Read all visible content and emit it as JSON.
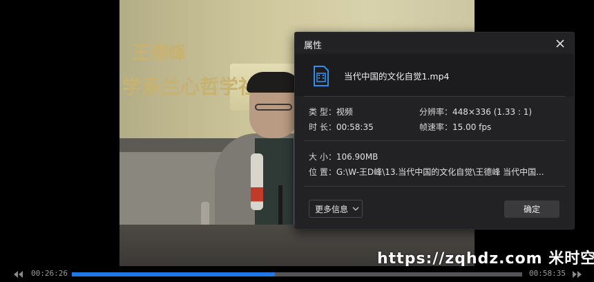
{
  "video": {
    "slide_line1": "王德峰",
    "slide_line2": "学系兰心哲学社"
  },
  "watermark": "https://zqhdz.com  米时空",
  "dialog": {
    "title": "属性",
    "close_icon": "close-icon",
    "file_icon": "video-file-icon",
    "filename": "当代中国的文化自觉1.mp4",
    "type_label": "类 型：",
    "type_value": "视频",
    "duration_label": "时 长：",
    "duration_value": "00:58:35",
    "resolution_label": "分辨率：",
    "resolution_value": "448×336 (1.33 : 1)",
    "framerate_label": "帧速率：",
    "framerate_value": "15.00 fps",
    "size_label": "大 小：",
    "size_value": "106.90MB",
    "location_label": "位 置：",
    "location_value": "G:\\W-王D峰\\13.当代中国的文化自觉\\王德峰 当代中国...",
    "more_button": "更多信息",
    "ok_button": "确定",
    "accent_color": "#1e78e6"
  },
  "player": {
    "current_time": "00:26:26",
    "total_time": "00:58:35",
    "progress": 0.451
  }
}
